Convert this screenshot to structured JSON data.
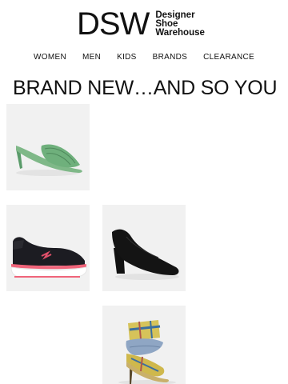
{
  "brand": {
    "mark": "DSW",
    "line1": "Designer",
    "line2": "Shoe",
    "line3": "Warehouse"
  },
  "nav": {
    "items": [
      "WOMEN",
      "MEN",
      "KIDS",
      "BRANDS",
      "CLEARANCE"
    ]
  },
  "headline": "BRAND NEW…AND SO YOU",
  "products": [
    {
      "icon": "green-heeled-slide-sandal-icon"
    },
    {
      "icon": "black-running-sneaker-icon"
    },
    {
      "icon": "black-block-heel-pump-icon"
    },
    {
      "icon": "plaid-denim-heeled-bootie-icon"
    }
  ]
}
